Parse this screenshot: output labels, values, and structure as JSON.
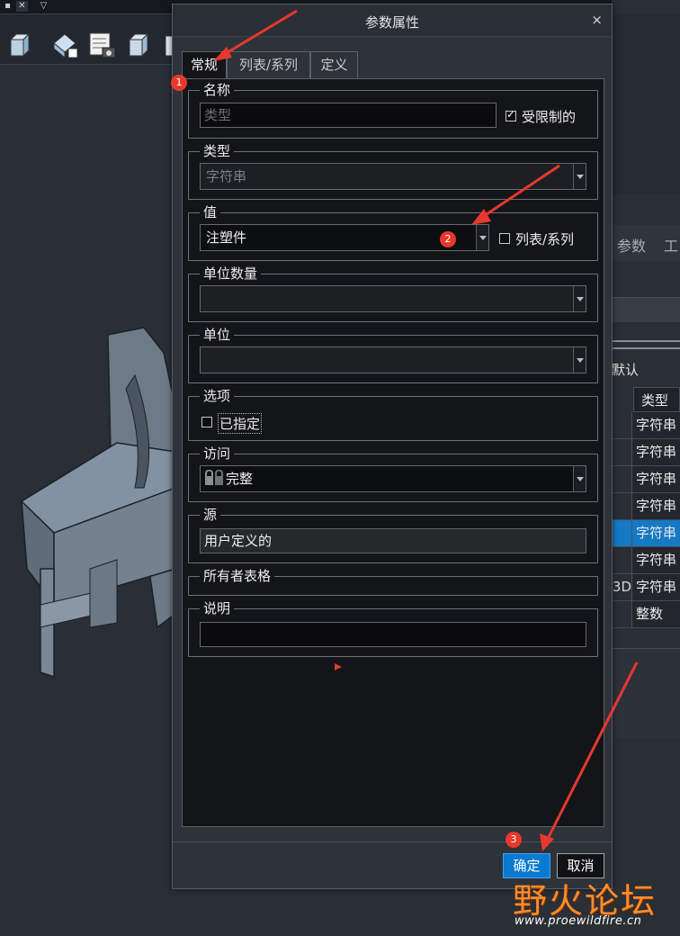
{
  "dialog": {
    "title": "参数属性",
    "close_glyph": "×",
    "tabs": [
      "常规",
      "列表/系列",
      "定义"
    ]
  },
  "general": {
    "name_label": "名称",
    "name_placeholder": "类型",
    "restricted_label": "受限制的",
    "restricted_checked": true,
    "type_label": "类型",
    "type_value": "字符串",
    "value_label": "值",
    "value_value": "注塑件",
    "list_series_label": "列表/系列",
    "list_series_checked": false,
    "unit_qty_label": "单位数量",
    "unit_qty_value": "",
    "unit_label": "单位",
    "unit_value": "",
    "options_label": "选项",
    "designated_label": "已指定",
    "designated_checked": false,
    "access_label": "访问",
    "access_value": "完整",
    "source_label": "源",
    "source_value": "用户定义的",
    "owner_table_label": "所有者表格",
    "description_label": "说明",
    "description_value": ""
  },
  "buttons": {
    "ok": "确定",
    "cancel": "取消"
  },
  "annotations": [
    "1",
    "2",
    "3"
  ],
  "background": {
    "right_tabs": [
      "参数",
      "工"
    ],
    "default_label": "默认",
    "table_header": "类型",
    "table_rows": [
      {
        "prefix": "",
        "type": "字符串",
        "selected": false
      },
      {
        "prefix": "",
        "type": "字符串",
        "selected": false
      },
      {
        "prefix": "",
        "type": "字符串",
        "selected": false
      },
      {
        "prefix": "",
        "type": "字符串",
        "selected": false
      },
      {
        "prefix": "",
        "type": "字符串",
        "selected": true
      },
      {
        "prefix": "",
        "type": "字符串",
        "selected": false
      },
      {
        "prefix": "3D",
        "type": "字符串",
        "selected": false
      },
      {
        "prefix": "",
        "type": "整数",
        "selected": false
      }
    ]
  },
  "watermark": {
    "title": "野火论坛",
    "url": "www.proewildfire.cn"
  },
  "colors": {
    "accent": "#0a7ad0",
    "annotation_red": "#e8382e",
    "selected_row": "#1679c4"
  }
}
